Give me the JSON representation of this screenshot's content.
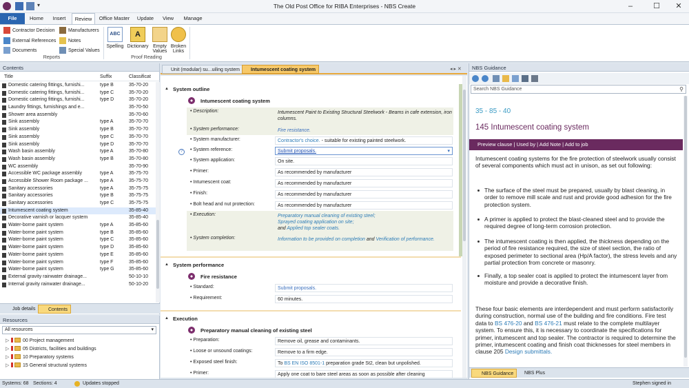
{
  "app": {
    "title": "The Old Post Office for RIBA Enterprises  -  NBS Create"
  },
  "tabs": [
    "File",
    "Home",
    "Insert",
    "Review",
    "Office Master",
    "Update",
    "View",
    "Manage"
  ],
  "ribbon": {
    "references": [
      "Contractor Decision",
      "External References",
      "Documents"
    ],
    "references2": [
      "Manufacturers",
      "Notes",
      "Special Values"
    ],
    "references_label": "Reports",
    "proof": [
      "Spelling",
      "Dictionary",
      "Empty Values",
      "Broken Links"
    ],
    "proof_label": "Proof Reading"
  },
  "contents": {
    "title": "Contents",
    "cols": [
      "Title",
      "Suffix",
      "Classificat"
    ],
    "rows": [
      [
        "Domestic catering fittings, furnishi...",
        "type B",
        "35-70-20"
      ],
      [
        "Domestic catering fittings, furnishi...",
        "type C",
        "35-70-20"
      ],
      [
        "Domestic catering fittings, furnishi...",
        "type D",
        "35-70-20"
      ],
      [
        "Laundry fittings, furnishings and e...",
        "",
        "35-70-50"
      ],
      [
        "Shower area assembly",
        "",
        "35-70-60"
      ],
      [
        "Sink assembly",
        "type A",
        "35-70-70"
      ],
      [
        "Sink assembly",
        "type B",
        "35-70-70"
      ],
      [
        "Sink assembly",
        "type C",
        "35-70-70"
      ],
      [
        "Sink assembly",
        "type D",
        "35-70-70"
      ],
      [
        "Wash basin assembly",
        "type A",
        "35-70-80"
      ],
      [
        "Wash basin assembly",
        "type B",
        "35-70-80"
      ],
      [
        "WC assembly",
        "",
        "35-70-90"
      ],
      [
        "Accessible WC package assembly",
        "type A",
        "35-75-70"
      ],
      [
        "Accessible Shower Room package ...",
        "type A",
        "35-75-70"
      ],
      [
        "Sanitary accessories",
        "type A",
        "35-75-75"
      ],
      [
        "Sanitary accessories",
        "type B",
        "35-75-75"
      ],
      [
        "Sanitary accessories",
        "type C",
        "35-75-75"
      ],
      [
        "Intumescent coating system",
        "",
        "35-85-40"
      ],
      [
        "Decorative varnish or lacquer system",
        "",
        "35-85-40"
      ],
      [
        "Water-borne paint system",
        "type A",
        "35-85-60"
      ],
      [
        "Water-borne paint system",
        "type B",
        "35-85-60"
      ],
      [
        "Water-borne paint system",
        "type C",
        "35-85-60"
      ],
      [
        "Water-borne paint system",
        "type D",
        "35-85-60"
      ],
      [
        "Water-borne paint system",
        "type E",
        "35-85-60"
      ],
      [
        "Water-borne paint system",
        "type F",
        "35-85-60"
      ],
      [
        "Water-borne paint system",
        "type G",
        "35-85-60"
      ],
      [
        "External gravity rainwater drainage...",
        "",
        "50-10-10"
      ],
      [
        "Internal gravity rainwater drainage...",
        "",
        "50-10-20"
      ]
    ],
    "selected_index": 17
  },
  "bottom_tabs": [
    "Job details",
    "Contents"
  ],
  "resources": {
    "title": "Resources",
    "filter": "All resources",
    "items": [
      "00 Project management",
      "05 Districts, facilities and buildings",
      "10 Preparatory systems",
      "15 General structural systems"
    ]
  },
  "status": {
    "systems": "Systems: 68",
    "sections": "Sections: 4",
    "updates": "Updates stopped",
    "user": "Stephen signed in"
  },
  "doc": {
    "tabs": [
      "Unit (modular) su...uiling system",
      "Intumescent coating system"
    ],
    "outline": {
      "heading": "System outline",
      "title": "Intumescent coating system",
      "fields": [
        {
          "label": "Description:",
          "value": "Intumescent Paint to Existing Structural Steelwork - Beams in cafe extension, iron columns."
        },
        {
          "label": "System performance:",
          "value": "Fire resistance."
        },
        {
          "label": "System manufacturer:",
          "value_a": "Contractor's choice.",
          "value_b": " - suitable for existing painted steelwork."
        },
        {
          "label": "System reference:",
          "value": "Submit proposals."
        },
        {
          "label": "System application:",
          "value": "On site."
        },
        {
          "label": "Primer:",
          "value": "As recommended by manufacturer"
        },
        {
          "label": "Intumescent coat:",
          "value": "As recommended by manufacturer"
        },
        {
          "label": "Finish:",
          "value": "As recommended by manufacturer"
        },
        {
          "label": "Bolt head and nut protection:",
          "value": "As recommended by manufacturer"
        },
        {
          "label": "Execution:",
          "value_a": "Preparatory manual cleaning of existing steel;",
          "value_b": "Sprayed coating application on site;",
          "value_c": "and",
          "value_d": "Applied top sealer coats."
        },
        {
          "label": "System completion:",
          "value_a": "Information to be provided on completion",
          "value_b": "and",
          "value_c": "Verification of performance."
        }
      ]
    },
    "performance": {
      "heading": "System performance",
      "title": "Fire resistance",
      "fields": [
        {
          "label": "Standard:",
          "value": "Submit proposals."
        },
        {
          "label": "Requirement:",
          "value": "60 minutes."
        }
      ]
    },
    "execution": {
      "heading": "Execution",
      "title": "Preparatory manual cleaning of existing steel",
      "fields": [
        {
          "label": "Preparation:",
          "value": "Remove oil, grease and contaminants."
        },
        {
          "label": "Loose or unsound coatings:",
          "value": "Remove to a firm edge."
        },
        {
          "label": "Exposed steel finish:",
          "value_a": "To",
          "value_b": "BS EN ISO 8501-1",
          "value_c": "preparation grade St2, clean but unpolished."
        },
        {
          "label": "Primer:",
          "value": "Apply one coat to bare steel areas as soon as possible after cleaning"
        }
      ]
    }
  },
  "guide": {
    "title": "NBS Guidance",
    "search_placeholder": "Search NBS Guidance",
    "code": "35 - 85 - 40",
    "heading": "145 Intumescent coating system",
    "bar": "Preview clause | Used by | Add Note | Add to job",
    "intro": "Intumescent coating systems for the fire protection of steelwork usually consist of several components which must act in unison, as set out following:",
    "bullets": [
      "The surface of the steel must be prepared, usually by blast cleaning, in order to remove mill scale and rust and provide good adhesion for the fire protection system.",
      "A primer is applied to protect the blast-cleaned steel and to provide the required degree of long-term corrosion protection.",
      "The intumescent coating is then applied, the thickness depending on the period of fire resistance required, the size of steel section, the ratio of exposed perimeter to sectional area (Hp/A factor), the stress levels and any partial protection from concrete or masonry.",
      "Finally, a top sealer coat is applied to protect the intumescent layer from moisture and provide a decorative finish."
    ],
    "para_a": "These four basic elements are interdependent and must perform satisfactorily during construction, normal use of the building and fire conditions. Fire test data to",
    "link1": "BS 476-20",
    "para_b": "and",
    "link2": "BS 476-21",
    "para_c": "must relate to the complete multilayer system. To ensure this, it is necessary to coordinate the specifications for primer, intumescent and top sealer. The contractor is required to determine the primer, intumescent coating and finish coat thicknesses for steel members in clause 205",
    "link3": "Design submittals.",
    "tabs": [
      "NBS Guidance",
      "NBS Plus"
    ]
  },
  "colors": {
    "accent": "#6a2a5f",
    "file_tab": "#2a65b0",
    "link": "#2c7bb6"
  }
}
